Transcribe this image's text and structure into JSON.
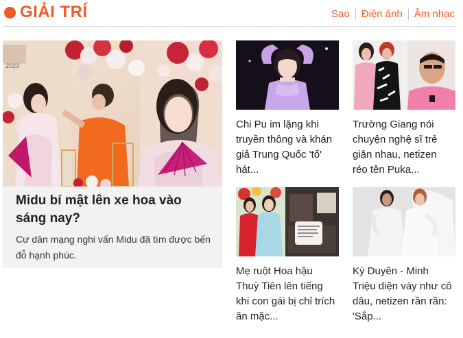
{
  "section": {
    "title": "GIẢI TRÍ",
    "nav": [
      "Sao",
      "Điện ảnh",
      "Âm nhạc"
    ],
    "accent_color": "#f05a28"
  },
  "featured": {
    "image_badge": "2023",
    "title": "Midu bí mật lên xe hoa vào sáng nay?",
    "description": "Cư dân mạng nghi vấn Midu đã tìm được bến đỗ hạnh phúc."
  },
  "articles": [
    {
      "title": "Chi Pu im lặng khi truyền thông và khán giả Trung Quốc 'tố' hát..."
    },
    {
      "title": "Trường Giang nói chuyện nghệ sĩ trẻ giận nhau, netizen réo tên Puka..."
    },
    {
      "title": "Mẹ ruột Hoa hậu Thuỳ Tiên lên tiếng khi con gái bị chỉ trích ăn mặc..."
    },
    {
      "title": "Kỳ Duyên - Minh Triệu diện váy như cô dâu, netizen rần rần: 'Sắp..."
    }
  ]
}
